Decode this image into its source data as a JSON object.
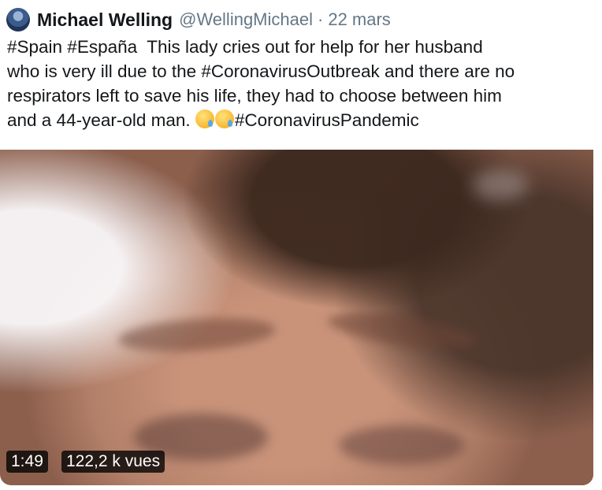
{
  "tweet": {
    "author_name": "Michael Welling",
    "handle": "@WellingMichael",
    "separator": "·",
    "date": "22 mars",
    "text_lines": [
      "#Spain #España  This lady cries out for help for her husband",
      "who is very ill due to the #CoronavirusOutbreak and there are no",
      "respirators left to save his life, they had to choose between him",
      "and a 44-year-old man. "
    ],
    "text_tail": "#CoronavirusPandemic",
    "emojis": [
      "crying-face",
      "crying-face"
    ]
  },
  "video": {
    "duration": "1:49",
    "views": "122,2 k vues"
  }
}
